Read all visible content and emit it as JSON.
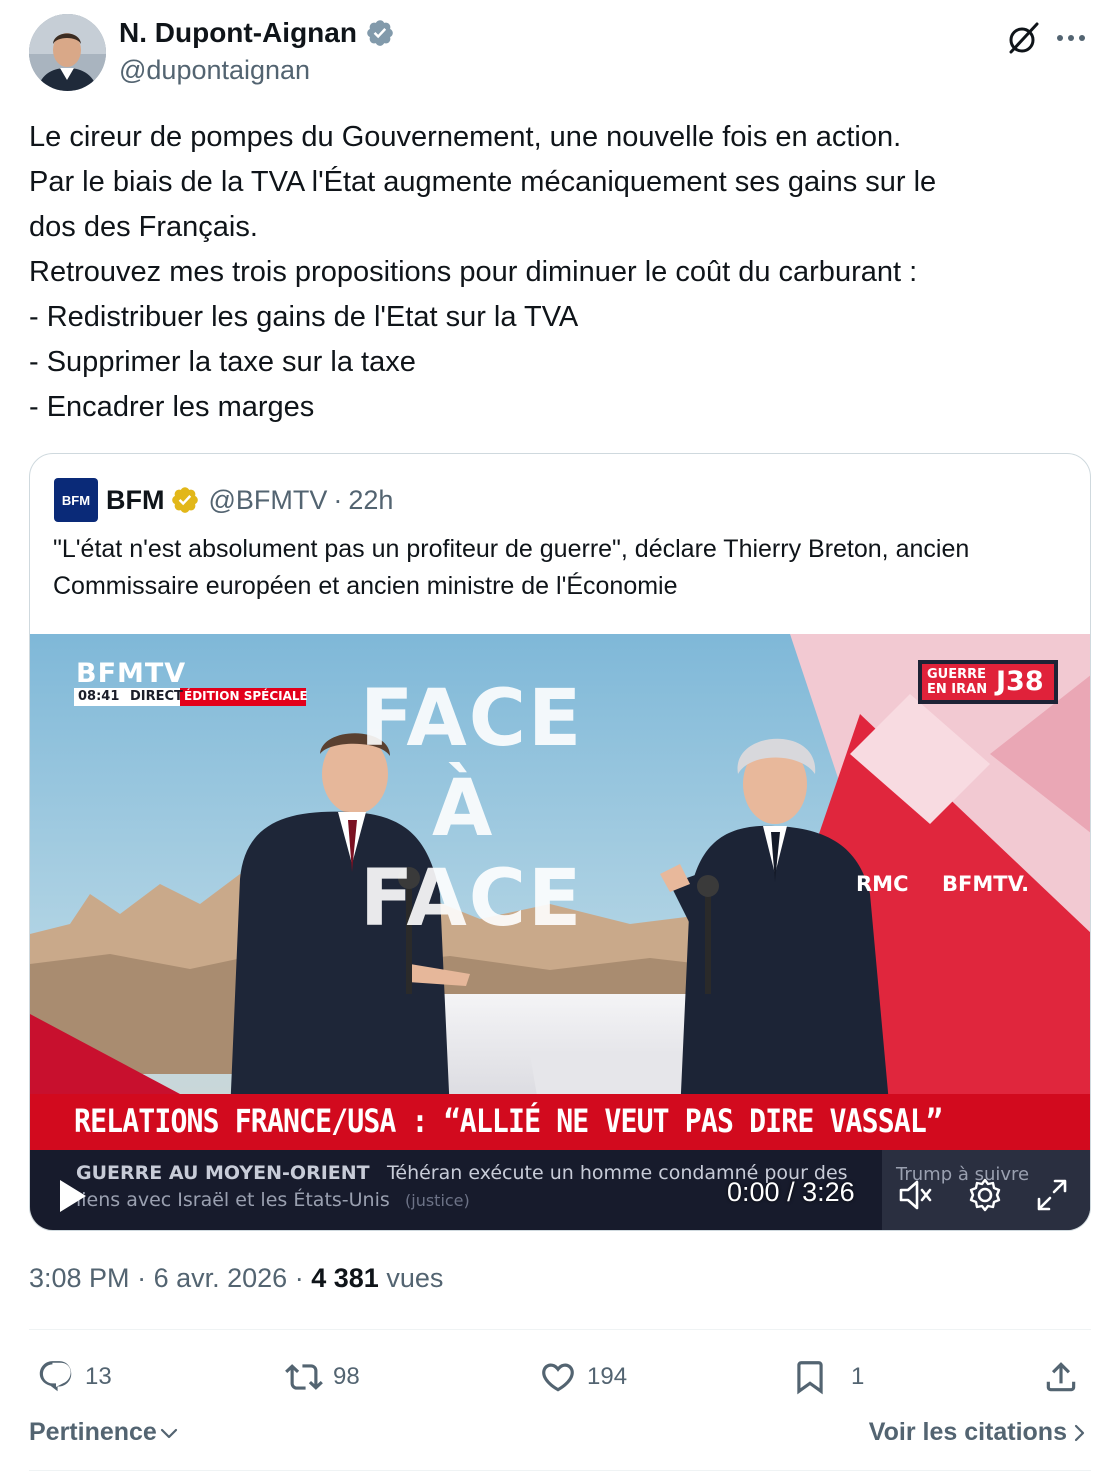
{
  "author": {
    "display_name": "N. Dupont-Aignan",
    "handle": "@dupontaignan"
  },
  "tweet": {
    "lines": [
      "Le cireur de pompes du Gouvernement, une nouvelle fois en action.",
      "Par le biais de la TVA l'État augmente mécaniquement ses gains sur le",
      "dos des Français.",
      "Retrouvez mes trois propositions pour diminuer le coût du carburant :",
      "- Redistribuer les gains de l'Etat sur la TVA",
      "- Supprimer la taxe sur la taxe",
      "- Encadrer les marges"
    ]
  },
  "quote": {
    "logo_text": "BFM",
    "name": "BFM",
    "handle": "@BFMTV",
    "age": "22h",
    "text": "\"L'état n'est absolument pas un profiteur de guerre\", déclare Thierry Breton, ancien Commissaire européen et ancien ministre de l'Économie"
  },
  "video": {
    "channel": "BFMTV",
    "clock": "08:41",
    "live": "DIRECT",
    "special": "ÉDITION SPÉCIALE",
    "show_title": [
      "FACE",
      "À",
      "FACE"
    ],
    "war_badge_top": "GUERRE",
    "war_badge_bottom": "EN IRAN",
    "war_day": "J38",
    "backdrop_brand_1": "RMC",
    "backdrop_brand_2": "BFMTV.",
    "headline": "RELATIONS FRANCE/USA : “ALLIÉ NE VEUT PAS DIRE VASSAL”",
    "ticker_label": "GUERRE AU MOYEN-ORIENT",
    "ticker_text_1": "Téhéran exécute un homme condamné pour des",
    "ticker_text_2": "liens avec Israël et les États-Unis",
    "ticker_text_3": "(justice)",
    "ticker_side": "Trump à suivre",
    "current_time": "0:00",
    "separator": "/",
    "duration": "3:26"
  },
  "meta": {
    "time": "3:08 PM",
    "dot": "·",
    "date": "6 avr. 2026",
    "views_count": "4 381",
    "views_label": "vues"
  },
  "actions": {
    "replies": "13",
    "reposts": "98",
    "likes": "194",
    "bookmarks": "1"
  },
  "footer": {
    "sort_label": "Pertinence",
    "quotes_link": "Voir les citations"
  },
  "colors": {
    "text_primary": "#0f1419",
    "text_secondary": "#536471",
    "verified_blue": "#1d9bf0",
    "verified_gold": "#e2b719",
    "bfm_red": "#e3001b",
    "border": "#cfd9de"
  },
  "icons": [
    "verified-badge-icon",
    "grok-icon",
    "more-icon",
    "gold-verified-icon",
    "play-icon",
    "volume-icon",
    "settings-icon",
    "fullscreen-icon",
    "reply-icon",
    "repost-icon",
    "like-icon",
    "bookmark-icon",
    "share-icon",
    "chevron-down-icon",
    "chevron-right-icon"
  ]
}
